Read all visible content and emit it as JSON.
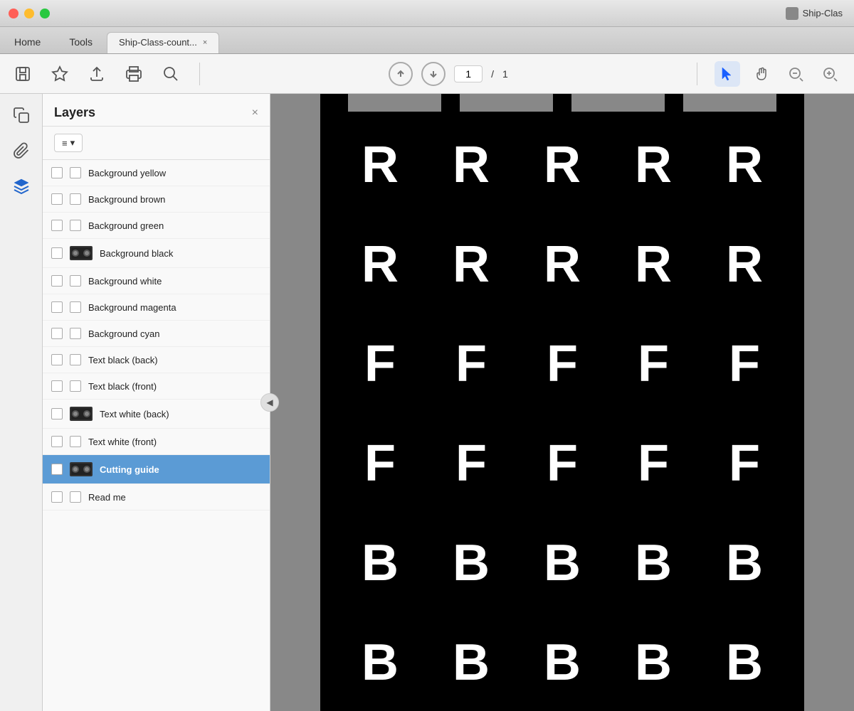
{
  "titlebar": {
    "app_name": "Ship-Clas",
    "controls": [
      "close",
      "minimize",
      "maximize"
    ]
  },
  "tabs": {
    "home": "Home",
    "tools": "Tools",
    "active_tab": "Ship-Class-count...",
    "close_label": "×"
  },
  "toolbar": {
    "save_label": "💾",
    "bookmark_label": "☆",
    "upload_label": "⬆",
    "print_label": "🖨",
    "search_label": "🔍",
    "nav_up": "↑",
    "nav_down": "↓",
    "page_current": "1",
    "page_sep": "/",
    "page_total": "1",
    "tool_cursor": "▶",
    "tool_hand": "✋",
    "tool_zoom_out": "−",
    "tool_zoom_in": "+"
  },
  "layers_panel": {
    "title": "Layers",
    "close_btn": "×",
    "view_btn": "≡ ▾",
    "items": [
      {
        "id": "bg-yellow",
        "label": "Background yellow",
        "has_thumb": false,
        "selected": false
      },
      {
        "id": "bg-brown",
        "label": "Background brown",
        "has_thumb": false,
        "selected": false
      },
      {
        "id": "bg-green",
        "label": "Background green",
        "has_thumb": false,
        "selected": false
      },
      {
        "id": "bg-black",
        "label": "Background black",
        "has_thumb": true,
        "selected": false
      },
      {
        "id": "bg-white",
        "label": "Background white",
        "has_thumb": false,
        "selected": false
      },
      {
        "id": "bg-magenta",
        "label": "Background magenta",
        "has_thumb": false,
        "selected": false
      },
      {
        "id": "bg-cyan",
        "label": "Background cyan",
        "has_thumb": false,
        "selected": false
      },
      {
        "id": "txt-blk-back",
        "label": "Text black (back)",
        "has_thumb": false,
        "selected": false
      },
      {
        "id": "txt-blk-front",
        "label": "Text black (front)",
        "has_thumb": false,
        "selected": false
      },
      {
        "id": "txt-wht-back",
        "label": "Text white (back)",
        "has_thumb": true,
        "selected": false
      },
      {
        "id": "txt-wht-front",
        "label": "Text white (front)",
        "has_thumb": false,
        "selected": false
      },
      {
        "id": "cutting-guide",
        "label": "Cutting guide",
        "has_thumb": true,
        "selected": true
      },
      {
        "id": "read-me",
        "label": "Read me",
        "has_thumb": false,
        "selected": false
      }
    ]
  },
  "pdf_grid": {
    "rows": [
      [
        "R",
        "R",
        "R",
        "R",
        "R"
      ],
      [
        "R",
        "R",
        "R",
        "R",
        "R"
      ],
      [
        "F",
        "F",
        "F",
        "F",
        "F"
      ],
      [
        "F",
        "F",
        "F",
        "F",
        "F"
      ],
      [
        "B",
        "B",
        "B",
        "B",
        "B"
      ],
      [
        "B",
        "B",
        "B",
        "B",
        "B"
      ]
    ]
  },
  "sidebar_icons": {
    "copy": "⧉",
    "clip": "🔗",
    "layers": "◈"
  }
}
